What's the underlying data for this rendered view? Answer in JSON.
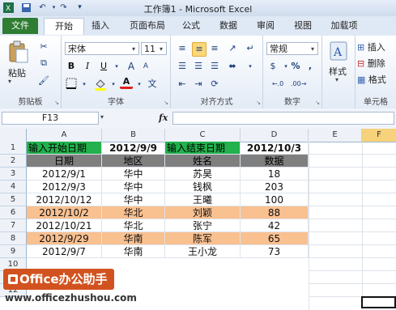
{
  "window": {
    "title": "工作簿1 - Microsoft Excel"
  },
  "tabs": [
    "文件",
    "开始",
    "插入",
    "页面布局",
    "公式",
    "数据",
    "审阅",
    "视图",
    "加载项"
  ],
  "ribbon": {
    "paste_label": "粘贴",
    "font_name": "宋体",
    "font_size": "11",
    "number_format": "常规",
    "styles_label": "样式",
    "insert_label": "插入",
    "delete_label": "删除",
    "format_label": "格式",
    "bold": "B",
    "italic": "I",
    "underline": "U",
    "font_color_char": "A",
    "grow_font": "A",
    "shrink_font": "A",
    "percent": "%",
    "comma": ",",
    "currency": "$",
    "groups": {
      "clipboard": "剪贴板",
      "font": "字体",
      "alignment": "对齐方式",
      "number": "数字",
      "cells": "单元格"
    },
    "colors": {
      "file_tab": "#2e7d32",
      "highlight": "#fbd77a"
    }
  },
  "formula_bar": {
    "name_box": "F13",
    "fx": "fx",
    "formula": ""
  },
  "columns": [
    "A",
    "B",
    "C",
    "D",
    "E",
    "F"
  ],
  "rows": [
    "1",
    "2",
    "3",
    "4",
    "5",
    "6",
    "7",
    "8",
    "9",
    "10",
    "11",
    "12"
  ],
  "sheet": {
    "row1": {
      "a": "输入开始日期",
      "b": "2012/9/9",
      "c": "输入结束日期",
      "d": "2012/10/3"
    },
    "header": {
      "a": "日期",
      "b": "地区",
      "c": "姓名",
      "d": "数据"
    },
    "data": [
      {
        "date": "2012/9/1",
        "region": "华中",
        "name": "苏昊",
        "value": "18",
        "highlight": false
      },
      {
        "date": "2012/9/3",
        "region": "华中",
        "name": "钱枫",
        "value": "203",
        "highlight": false
      },
      {
        "date": "2012/10/12",
        "region": "华中",
        "name": "王曦",
        "value": "100",
        "highlight": false
      },
      {
        "date": "2012/10/2",
        "region": "华北",
        "name": "刘颖",
        "value": "88",
        "highlight": true
      },
      {
        "date": "2012/10/21",
        "region": "华北",
        "name": "张宁",
        "value": "42",
        "highlight": false
      },
      {
        "date": "2012/9/29",
        "region": "华南",
        "name": "陈军",
        "value": "65",
        "highlight": true
      },
      {
        "date": "2012/9/7",
        "region": "华南",
        "name": "王小龙",
        "value": "73",
        "highlight": false
      }
    ],
    "colors": {
      "input_label": "#22b14c",
      "header": "#7f7f7f",
      "highlight_row": "#f9c090"
    }
  },
  "watermark": {
    "brand": "Office办公助手",
    "url": "www.officezhushou.com"
  }
}
